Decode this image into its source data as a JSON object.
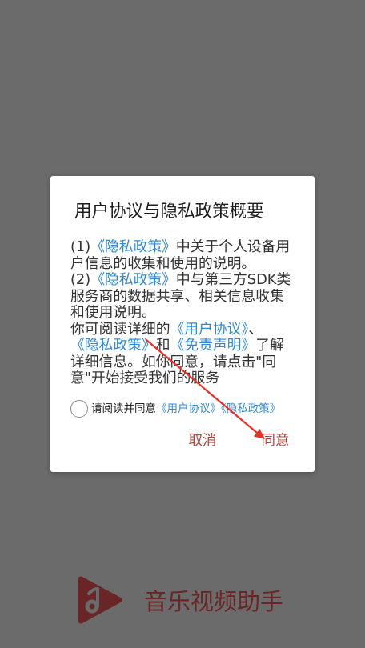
{
  "dialog": {
    "title": "用户协议与隐私政策概要",
    "body_lines": [
      {
        "segments": [
          {
            "text": "(1)",
            "link": false
          },
          {
            "text": "《隐私政策》",
            "link": true
          },
          {
            "text": "中关于个人设备用",
            "link": false
          }
        ]
      },
      {
        "segments": [
          {
            "text": "户信息的收集和使用的说明。",
            "link": false
          }
        ]
      },
      {
        "segments": [
          {
            "text": "(2)",
            "link": false
          },
          {
            "text": "《隐私政策》",
            "link": true
          },
          {
            "text": "中与第三方SDK类",
            "link": false
          }
        ]
      },
      {
        "segments": [
          {
            "text": "服务商的数据共享、相关信息收集",
            "link": false
          }
        ]
      },
      {
        "segments": [
          {
            "text": "和使用说明。",
            "link": false
          }
        ]
      },
      {
        "segments": [
          {
            "text": "你可阅读详细的",
            "link": false
          },
          {
            "text": "《用户协议》",
            "link": true
          },
          {
            "text": "、",
            "link": false
          }
        ]
      },
      {
        "segments": [
          {
            "text": "《隐私政策》",
            "link": true
          },
          {
            "text": "和",
            "link": false
          },
          {
            "text": "《免责声明》",
            "link": true
          },
          {
            "text": "了解",
            "link": false
          }
        ]
      },
      {
        "segments": [
          {
            "text": "详细信息。如你同意，请点击\"同",
            "link": false
          }
        ]
      },
      {
        "segments": [
          {
            "text": "意\"开始接受我们的服务",
            "link": false
          }
        ]
      }
    ],
    "consent": {
      "checked": false,
      "prefix": "请阅读并同意",
      "user_agreement": "《用户协议》",
      "privacy_policy": "《隐私政策》"
    },
    "buttons": {
      "cancel": "取消",
      "agree": "同意"
    }
  },
  "app": {
    "name": "音乐视频助手",
    "logo_icon": "music-play-logo-icon"
  },
  "colors": {
    "bg": "#6b6b6b",
    "link": "#2f8ad6",
    "button": "#b3443c",
    "brand": "#6a2626",
    "arrow": "#e8302a"
  }
}
